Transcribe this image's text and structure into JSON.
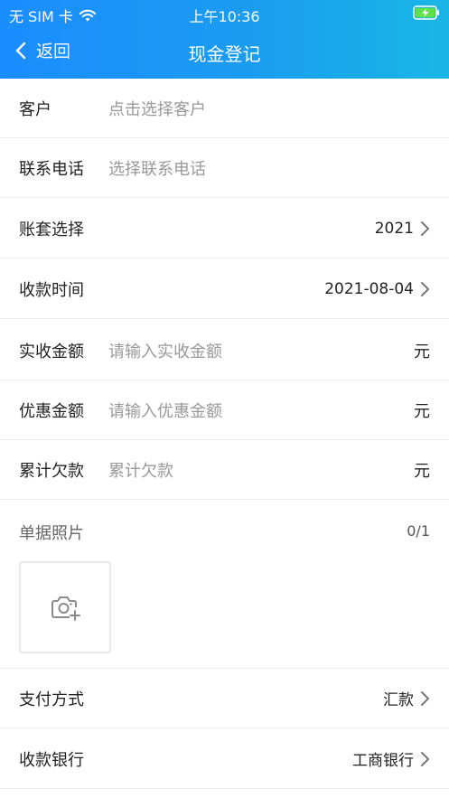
{
  "status_bar": {
    "carrier": "无 SIM 卡",
    "time": "上午10:36"
  },
  "nav": {
    "back_label": "返回",
    "title": "现金登记"
  },
  "form": {
    "customer": {
      "label": "客户",
      "placeholder": "点击选择客户"
    },
    "phone": {
      "label": "联系电话",
      "placeholder": "选择联系电话"
    },
    "account_set": {
      "label": "账套选择",
      "value": "2021"
    },
    "receipt_time": {
      "label": "收款时间",
      "value": "2021-08-04"
    },
    "received_amount": {
      "label": "实收金额",
      "placeholder": "请输入实收金额",
      "unit": "元"
    },
    "discount_amount": {
      "label": "优惠金额",
      "placeholder": "请输入优惠金额",
      "unit": "元"
    },
    "total_debt": {
      "label": "累计欠款",
      "placeholder": "累计欠款",
      "unit": "元"
    },
    "receipt_photo": {
      "label": "单据照片",
      "count": "0/1"
    },
    "payment_method": {
      "label": "支付方式",
      "value": "汇款"
    },
    "receiving_bank": {
      "label": "收款银行",
      "value": "工商银行"
    }
  },
  "colors": {
    "header_start": "#1a8dff",
    "header_end": "#1ab6e6",
    "battery_charging": "#5ee04a"
  },
  "icons": [
    "wifi-icon",
    "battery-charging-icon",
    "chevron-left-icon",
    "chevron-right-icon",
    "camera-plus-icon"
  ]
}
